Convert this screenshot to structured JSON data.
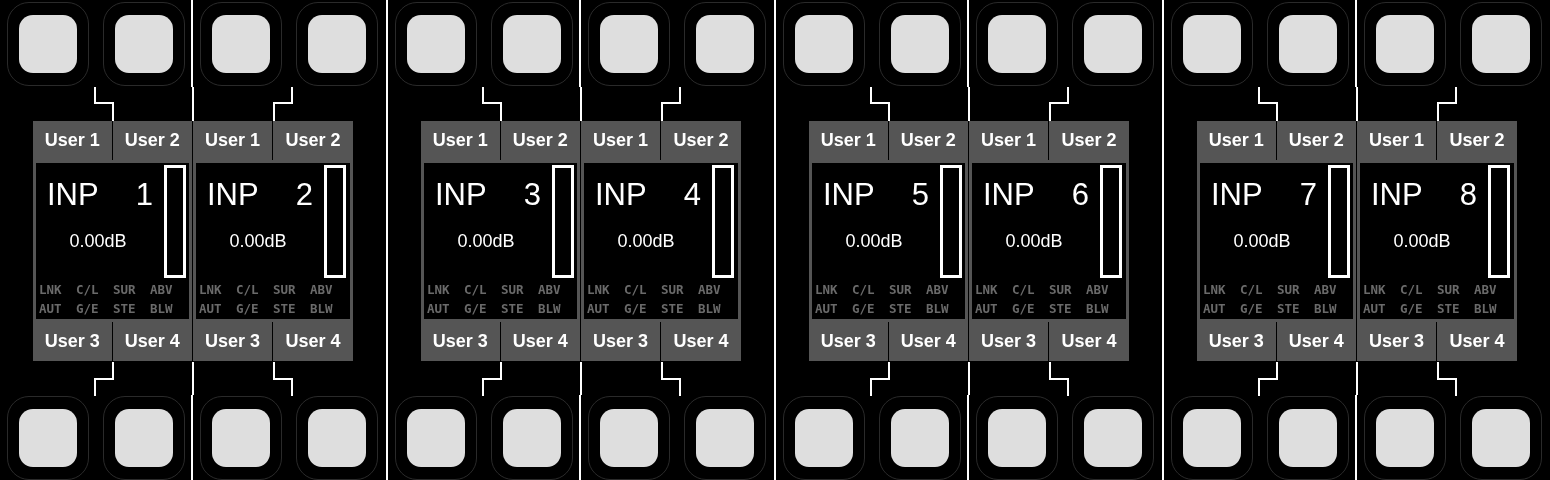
{
  "channels": [
    {
      "name": "INP",
      "number": "1",
      "gain": "0.00dB",
      "level": 0,
      "top_labels": [
        "User 1",
        "User 2"
      ],
      "bottom_labels": [
        "User 3",
        "User 4"
      ],
      "flags": [
        [
          "LNK",
          "C/L",
          "SUR",
          "ABV"
        ],
        [
          "AUT",
          "G/E",
          "STE",
          "BLW"
        ]
      ]
    },
    {
      "name": "INP",
      "number": "2",
      "gain": "0.00dB",
      "level": 0,
      "top_labels": [
        "User 1",
        "User 2"
      ],
      "bottom_labels": [
        "User 3",
        "User 4"
      ],
      "flags": [
        [
          "LNK",
          "C/L",
          "SUR",
          "ABV"
        ],
        [
          "AUT",
          "G/E",
          "STE",
          "BLW"
        ]
      ]
    },
    {
      "name": "INP",
      "number": "3",
      "gain": "0.00dB",
      "level": 0,
      "top_labels": [
        "User 1",
        "User 2"
      ],
      "bottom_labels": [
        "User 3",
        "User 4"
      ],
      "flags": [
        [
          "LNK",
          "C/L",
          "SUR",
          "ABV"
        ],
        [
          "AUT",
          "G/E",
          "STE",
          "BLW"
        ]
      ]
    },
    {
      "name": "INP",
      "number": "4",
      "gain": "0.00dB",
      "level": 0,
      "top_labels": [
        "User 1",
        "User 2"
      ],
      "bottom_labels": [
        "User 3",
        "User 4"
      ],
      "flags": [
        [
          "LNK",
          "C/L",
          "SUR",
          "ABV"
        ],
        [
          "AUT",
          "G/E",
          "STE",
          "BLW"
        ]
      ]
    },
    {
      "name": "INP",
      "number": "5",
      "gain": "0.00dB",
      "level": 0,
      "top_labels": [
        "User 1",
        "User 2"
      ],
      "bottom_labels": [
        "User 3",
        "User 4"
      ],
      "flags": [
        [
          "LNK",
          "C/L",
          "SUR",
          "ABV"
        ],
        [
          "AUT",
          "G/E",
          "STE",
          "BLW"
        ]
      ]
    },
    {
      "name": "INP",
      "number": "6",
      "gain": "0.00dB",
      "level": 0,
      "top_labels": [
        "User 1",
        "User 2"
      ],
      "bottom_labels": [
        "User 3",
        "User 4"
      ],
      "flags": [
        [
          "LNK",
          "C/L",
          "SUR",
          "ABV"
        ],
        [
          "AUT",
          "G/E",
          "STE",
          "BLW"
        ]
      ]
    },
    {
      "name": "INP",
      "number": "7",
      "gain": "0.00dB",
      "level": 0,
      "top_labels": [
        "User 1",
        "User 2"
      ],
      "bottom_labels": [
        "User 3",
        "User 4"
      ],
      "flags": [
        [
          "LNK",
          "C/L",
          "SUR",
          "ABV"
        ],
        [
          "AUT",
          "G/E",
          "STE",
          "BLW"
        ]
      ]
    },
    {
      "name": "INP",
      "number": "8",
      "gain": "0.00dB",
      "level": 0,
      "top_labels": [
        "User 1",
        "User 2"
      ],
      "bottom_labels": [
        "User 3",
        "User 4"
      ],
      "flags": [
        [
          "LNK",
          "C/L",
          "SUR",
          "ABV"
        ],
        [
          "AUT",
          "G/E",
          "STE",
          "BLW"
        ]
      ]
    }
  ]
}
